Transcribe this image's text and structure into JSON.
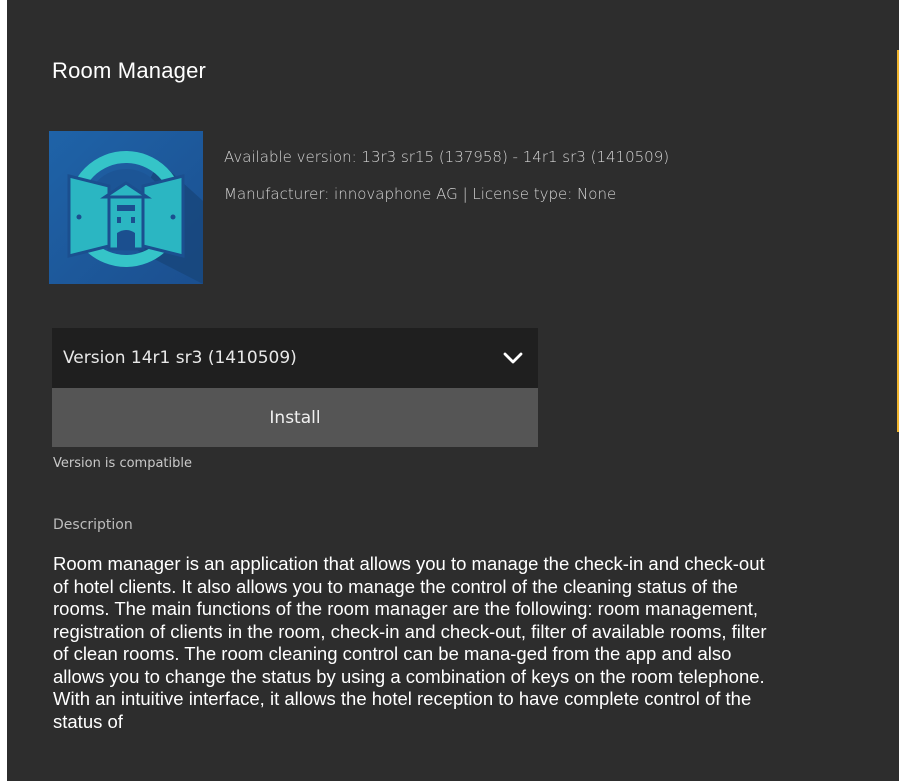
{
  "app": {
    "title": "Room Manager",
    "icon": "room-manager-app-icon",
    "available_version": "Available version: 13r3 sr15 (137958) - 14r1 sr3 (1410509)",
    "manufacturer": "Manufacturer: innovaphone AG | License type: None"
  },
  "version_select": {
    "selected": "Version 14r1 sr3 (1410509)",
    "icon": "chevron-down-icon"
  },
  "install": {
    "label": "Install",
    "status": "Version is compatible"
  },
  "description": {
    "heading": "Description",
    "text": "Room manager is an application that allows you to manage the check-in and check-out of hotel clients. It also allows you to manage the control of the cleaning status of the rooms. The main functions of the room manager are the following: room management, registration of clients in the room, check-in and check-out, filter of available rooms, filter of clean rooms. The room cleaning control can be mana-ged from the app and also allows you to change the status by using a combination of keys on the room telephone. With an intuitive interface, it allows the hotel reception to have complete control of the status of"
  },
  "colors": {
    "background": "#2d2d2d",
    "select_bg": "#1f1f1f",
    "button_bg": "#555555",
    "scrollbar_accent": "#f0b52e"
  }
}
